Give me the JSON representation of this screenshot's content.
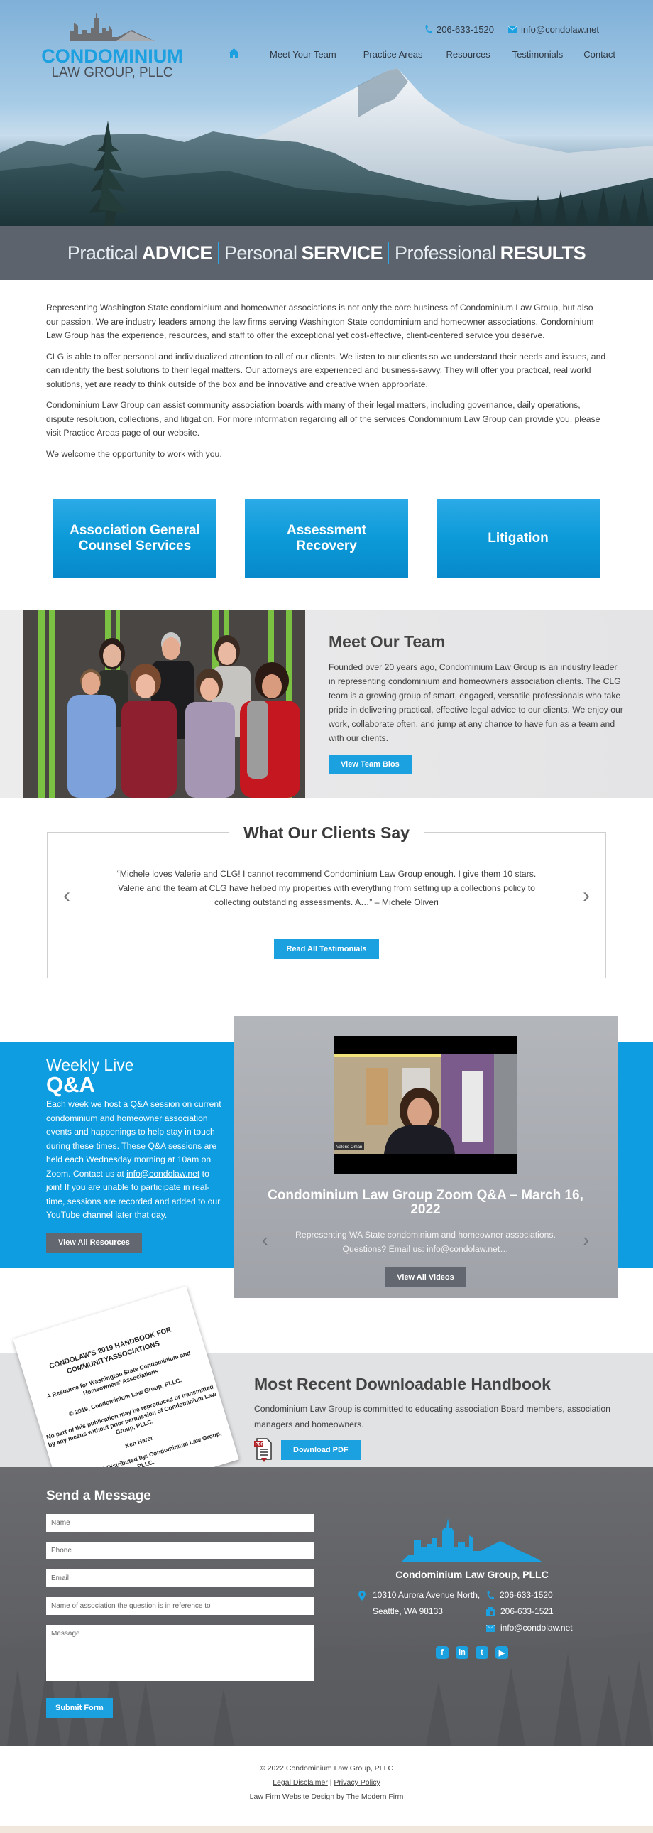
{
  "header": {
    "logo": {
      "line1": "CONDOMINIUM",
      "line2": "LAW GROUP, PLLC"
    },
    "phone": "206-633-1520",
    "email": "info@condolaw.net",
    "nav": [
      {
        "label": "Meet Your Team"
      },
      {
        "label": "Practice Areas"
      },
      {
        "label": "Resources"
      },
      {
        "label": "Testimonials"
      },
      {
        "label": "Contact"
      }
    ]
  },
  "tagline": {
    "parts": [
      {
        "light": "Practical",
        "bold": "ADVICE"
      },
      {
        "light": "Personal",
        "bold": "SERVICE"
      },
      {
        "light": "Professional",
        "bold": "RESULTS"
      }
    ]
  },
  "intro": {
    "paragraphs": [
      "Representing Washington State condominium and homeowner associations is not only the core business of Condominium Law Group, but also our passion. We are industry leaders among the law firms serving Washington State condominium and homeowner associations. Condominium Law Group has the experience, resources, and staff to offer the exceptional yet cost-effective, client-centered service you deserve.",
      "CLG is able to offer personal and individualized attention to all of our clients. We listen to our clients so we understand their needs and issues, and can identify the best solutions to their legal matters. Our attorneys are experienced and business-savvy. They will offer you practical, real world solutions, yet are ready to think outside of the box and be innovative and creative when appropriate.",
      "Condominium Law Group can assist community association boards with many of their legal matters, including governance, daily operations, dispute resolution, collections, and litigation. For more information regarding all of the services Condominium Law Group can provide you, please visit Practice Areas page of our website.",
      "We welcome the opportunity to work with you."
    ]
  },
  "practice_areas": [
    {
      "label": "Association General Counsel Services"
    },
    {
      "label": "Assessment Recovery"
    },
    {
      "label": "Litigation"
    }
  ],
  "team": {
    "title": "Meet Our Team",
    "body": "Founded over 20 years ago, Condominium Law Group is an industry leader in representing condominium and homeowners association clients. The CLG team is a growing group of smart, engaged, versatile professionals who take pride in delivering practical, effective legal advice to our clients. We enjoy our work, collaborate often, and jump at any chance to have fun as a team and with our clients.",
    "button": "View Team Bios"
  },
  "testimonials": {
    "title": "What Our Clients Say",
    "quote": "“Michele loves Valerie and CLG! I cannot recommend Condominium Law Group enough. I give them 10 stars. Valerie and the team at CLG have helped my properties with everything from setting up a collections policy to collecting outstanding assessments. A…” – Michele Oliveri",
    "button": "Read All Testimonials",
    "prev": "‹",
    "next": "›"
  },
  "qa": {
    "title_line1": "Weekly Live",
    "title_line2": "Q&A",
    "body_before": "Each week we host a Q&A session on current condominium and homeowner association events and happenings to help stay in touch during these times. These Q&A sessions are held each Wednesday morning at 10am on Zoom. Contact us at ",
    "body_link": "info@condolaw.net",
    "body_after": " to join! If you are unable to participate in real-time, sessions are recorded and added to our YouTube channel later that day.",
    "button": "View All Resources",
    "video": {
      "participant_label": "Valerie Oman",
      "title": "Condominium Law Group Zoom Q&A – March 16, 2022",
      "description": "Representing WA State condominium and homeowner associations. Questions? Email us: info@condolaw.net…",
      "button": "View All Videos",
      "prev": "‹",
      "next": "›"
    }
  },
  "handbook": {
    "doc": {
      "title": "CONDOLAW'S 2019 HANDBOOK FOR COMMUNITYASSOCIATIONS",
      "subtitle": "A Resource for Washington State Condominium and Homeowners' Associations",
      "copyright": "© 2019, Condominium Law Group, PLLC.",
      "notice": "No part of this publication may be reproduced or transmitted by any means without prior permission of Condominium Law Group, PLLC.",
      "author": "Ken Harer",
      "published": "Published and Distributed by: Condominium Law Group, PLLC."
    },
    "title": "Most Recent Downloadable Handbook",
    "body": "Condominium Law Group is committed to educating association Board members, association managers and homeowners.",
    "pdf_icon_label": "PDF",
    "button": "Download PDF"
  },
  "contact_form": {
    "title": "Send a Message",
    "fields": {
      "name": "Name",
      "phone": "Phone",
      "email": "Email",
      "association": "Name of association the question is in reference to",
      "message": "Message"
    },
    "submit": "Submit Form"
  },
  "footer_contact": {
    "name": "Condominium Law Group, PLLC",
    "address_line1": "10310 Aurora Avenue North,",
    "address_line2": "Seattle, WA 98133",
    "phone": "206-633-1520",
    "fax": "206-633-1521",
    "email": "info@condolaw.net",
    "social": [
      "f",
      "in",
      "t",
      "▶"
    ]
  },
  "bottom": {
    "copyright": "© 2022 Condominium Law Group, PLLC",
    "legal": "Legal Disclaimer",
    "divider": "|",
    "privacy": "Privacy Policy",
    "credit": "Law Firm Website Design by The Modern Firm"
  },
  "colors": {
    "brand_blue": "#1ba0e0",
    "tagline_bg": "#5c636c",
    "footer_bg": "#616266",
    "grey_button": "#636770"
  }
}
